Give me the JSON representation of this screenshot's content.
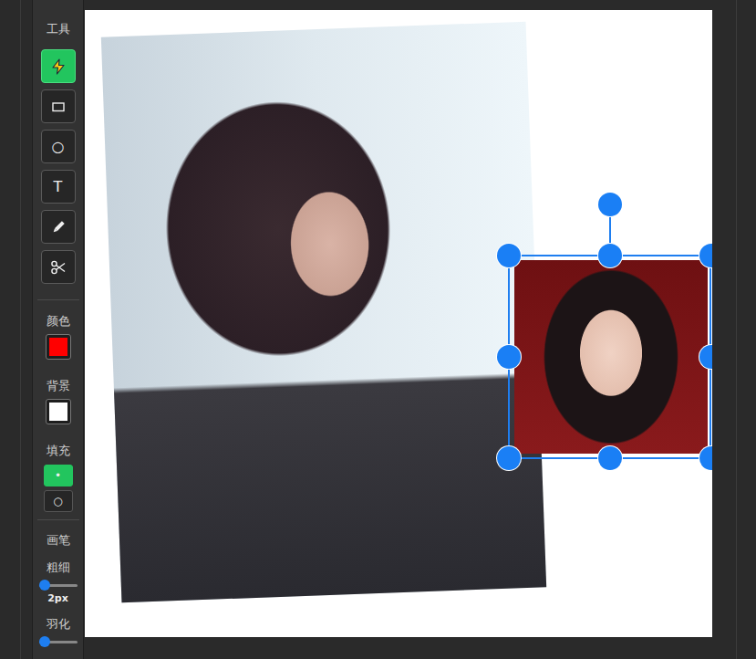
{
  "toolbar": {
    "title": "工具",
    "tools": [
      {
        "kind": "svg",
        "glyph": "",
        "selected": true
      },
      {
        "kind": "svg",
        "glyph": "",
        "selected": false
      },
      {
        "kind": "glyph",
        "glyph": "○",
        "selected": false
      },
      {
        "kind": "glyph",
        "glyph": "T",
        "selected": false
      },
      {
        "kind": "svg",
        "glyph": "",
        "selected": false
      },
      {
        "kind": "svg",
        "glyph": "",
        "selected": false
      }
    ]
  },
  "color": {
    "label": "颜色",
    "value": "#ff0000"
  },
  "background": {
    "label": "背景",
    "value": "#ffffff"
  },
  "fill": {
    "label": "填充",
    "options": [
      {
        "glyph": "•",
        "selected": true
      },
      {
        "glyph": "○",
        "selected": false
      }
    ]
  },
  "brush": {
    "title": "画笔",
    "thickness": {
      "label": "粗细",
      "level": 0,
      "reading": "2px"
    },
    "feather": {
      "label": "羽化",
      "level": 0
    }
  },
  "canvas": {
    "images": [
      {
        "selected": false
      },
      {
        "selected": true
      }
    ]
  }
}
